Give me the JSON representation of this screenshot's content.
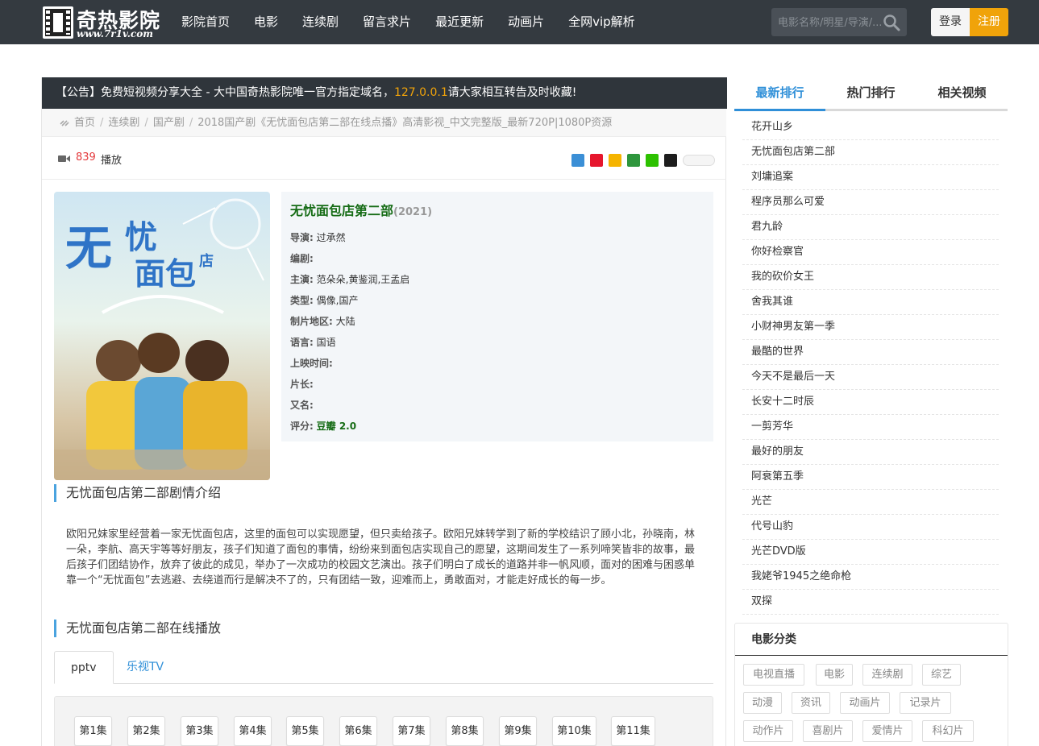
{
  "header": {
    "logo_title": "奇热影院",
    "logo_sub": "www.7r1v.com",
    "nav": [
      "影院首页",
      "电影",
      "连续剧",
      "留言求片",
      "最近更新",
      "动画片",
      "全网vip解析"
    ],
    "search_placeholder": "电影名称/明星/导演/...",
    "login_label": "登录",
    "register_label": "注册"
  },
  "notice": {
    "prefix": "【公告】免费短视频分享大全 - 大中国奇热影院唯一官方指定域名，",
    "highlight": "127.0.0.1",
    "suffix": "请大家相互转告及时收藏!"
  },
  "breadcrumb": [
    "首页",
    "连续剧",
    "国产剧",
    "2018国产剧《无忧面包店第二部在线点播》高清影视_中文完整版_最新720P|1080P资源"
  ],
  "play": {
    "count": "839",
    "label": "播放"
  },
  "movie": {
    "title": "无忧面包店第二部",
    "year": "(2021)",
    "rows": [
      {
        "label": "导演:",
        "value": "过承然"
      },
      {
        "label": "编剧:",
        "value": ""
      },
      {
        "label": "主演:",
        "value": "范朵朵,黄鉴润,王孟启"
      },
      {
        "label": "类型:",
        "value": "偶像,国产"
      },
      {
        "label": "制片地区:",
        "value": "大陆"
      },
      {
        "label": "语言:",
        "value": "国语"
      },
      {
        "label": "上映时间:",
        "value": ""
      },
      {
        "label": "片长:",
        "value": ""
      },
      {
        "label": "又名:",
        "value": ""
      }
    ],
    "score_label": "评分:",
    "score": "豆瓣 2.0",
    "poster_text": "无忧面包店"
  },
  "intro": {
    "title": "无忧面包店第二部剧情介绍",
    "text": "欧阳兄妹家里经营着一家无忧面包店，这里的面包可以实现愿望，但只卖给孩子。欧阳兄妹转学到了新的学校结识了顾小北，孙晓南，林一朵，李航、高天宇等等好朋友，孩子们知道了面包的事情，纷纷来到面包店实现自己的愿望，这期间发生了一系列啼笑皆非的故事，最后孩子们团结协作，放弃了彼此的成见，举办了一次成功的校园文艺演出。孩子们明白了成长的道路并非一帆风顺，面对的困难与困惑单靠一个“无忧面包”去逃避、去绕道而行是解决不了的，只有团结一致，迎难而上，勇敢面对，才能走好成长的每一步。"
  },
  "online": {
    "title": "无忧面包店第二部在线播放",
    "tabs": [
      "pptv",
      "乐视TV"
    ],
    "episodes": [
      "第1集",
      "第2集",
      "第3集",
      "第4集",
      "第5集",
      "第6集",
      "第7集",
      "第8集",
      "第9集",
      "第10集",
      "第11集"
    ]
  },
  "sidebar": {
    "tabs": [
      "最新排行",
      "热门排行",
      "相关视频"
    ],
    "ranking": [
      "花开山乡",
      "无忧面包店第二部",
      "刘墉追案",
      "程序员那么可爱",
      "君九龄",
      "你好检察官",
      "我的砍价女王",
      "舍我其谁",
      "小财神男友第一季",
      "最酷的世界",
      "今天不是最后一天",
      "长安十二时辰",
      "一剪芳华",
      "最好的朋友",
      "阿衰第五季",
      "光芒",
      "代号山豹",
      "光芒DVD版",
      "我姥爷1945之绝命枪",
      "双探"
    ],
    "category_title": "电影分类",
    "categories": [
      "电视直播",
      "电影",
      "连续剧",
      "综艺",
      "动漫",
      "资讯",
      "动画片",
      "记录片",
      "动作片",
      "喜剧片",
      "爱情片",
      "科幻片"
    ]
  },
  "colors": {
    "header_bg": "#343a40",
    "accent": "#2f8fd8",
    "register": "#f0a30a",
    "score": "#166c16"
  }
}
